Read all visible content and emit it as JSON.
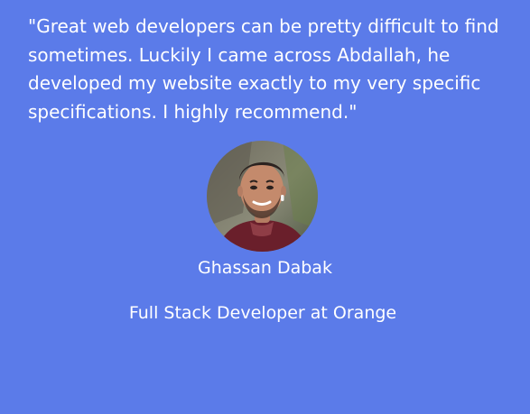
{
  "testimonial": {
    "quote": "\"Great web developers can be pretty difficult to find sometimes. Luckily I came across Abdallah, he developed my website exactly to my very specific specifications. I highly recommend.\"",
    "author_name": "Ghassan Dabak",
    "author_role": "Full Stack Developer at Orange"
  },
  "colors": {
    "background": "#5b7be9",
    "text": "#ffffff"
  },
  "icons": {
    "avatar": "author-photo"
  }
}
